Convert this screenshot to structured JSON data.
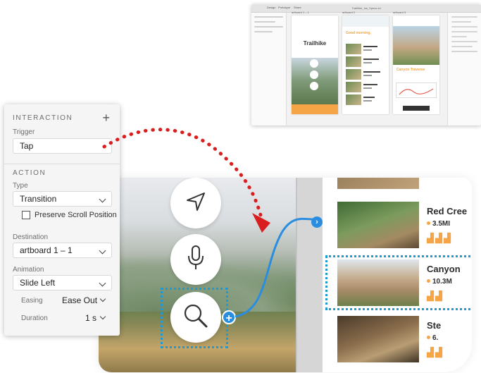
{
  "thumbnail": {
    "window_title": "Trailhike_Ios_Specs.xd",
    "tabs": [
      "Design",
      "Prototype",
      "Share"
    ],
    "artboard_labels": [
      "artboard 1 – 1",
      "artboard 2",
      "artboard 3"
    ],
    "app_logo": "Trailhike",
    "greeting": "Good morning,",
    "trail_names": [
      "Silver Trail",
      "Red Creek Trail",
      "Canyon Traverse",
      "Steep Hill Trail",
      "Pinon Loop"
    ],
    "detail_title": "Canyon Traverse"
  },
  "panel": {
    "section_interaction": "INTERACTION",
    "add_icon": "plus-icon",
    "trigger_label": "Trigger",
    "trigger_value": "Tap",
    "section_action": "ACTION",
    "type_label": "Type",
    "type_value": "Transition",
    "preserve_scroll_label": "Preserve Scroll Position",
    "preserve_scroll_checked": false,
    "destination_label": "Destination",
    "destination_value": "artboard 1 – 1",
    "animation_label": "Animation",
    "animation_value": "Slide Left",
    "easing_label": "Easing",
    "easing_value": "Ease Out",
    "duration_label": "Duration",
    "duration_value": "1 s"
  },
  "prototype": {
    "buttons": [
      {
        "name": "navigate-icon"
      },
      {
        "name": "microphone-icon"
      },
      {
        "name": "search-icon"
      }
    ],
    "trails": [
      {
        "name": "Red Cree",
        "distance": "3.5MI",
        "rating": 3
      },
      {
        "name": "Canyon",
        "distance": "10.3M",
        "rating": 3
      },
      {
        "name": "Ste",
        "distance": "6.",
        "rating": 3
      }
    ]
  },
  "colors": {
    "accent_blue": "#2a8ee0",
    "dotted_selection": "#1e9ad6",
    "wire_red": "#d81e1e",
    "brand_orange": "#f5a545"
  }
}
